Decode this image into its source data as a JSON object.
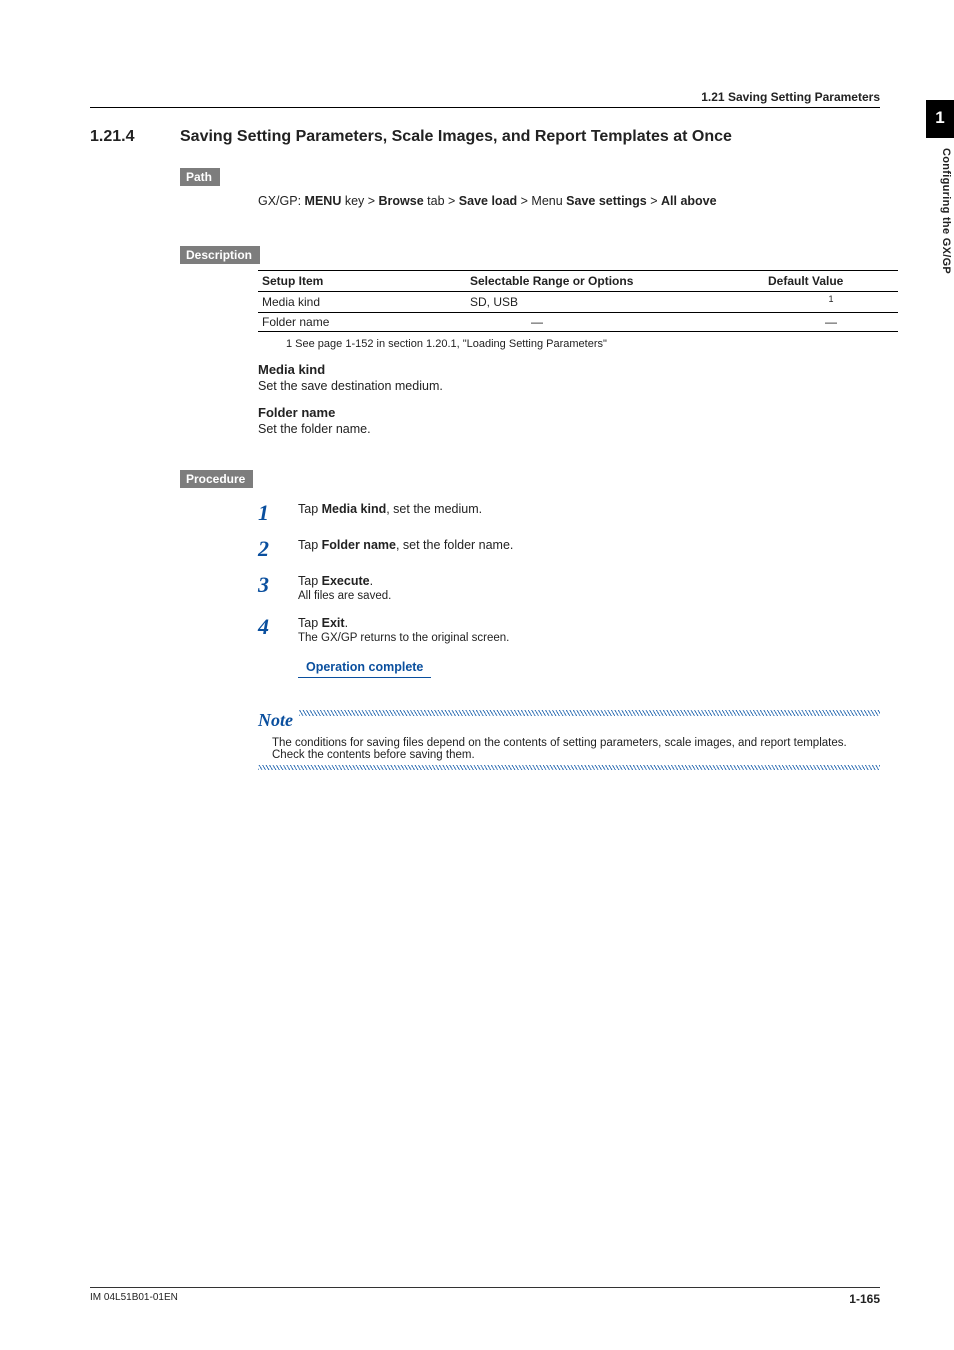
{
  "side_tab": "1",
  "side_label": "Configuring the GX/GP",
  "running_header": "1.21  Saving Setting Parameters",
  "section_number": "1.21.4",
  "section_title": "Saving Setting Parameters, Scale Images, and Report Templates at Once",
  "badges": {
    "path": "Path",
    "description": "Description",
    "procedure": "Procedure"
  },
  "path": {
    "prefix": "GX/GP: ",
    "k1": "MENU",
    "t1": " key > ",
    "k2": "Browse",
    "t2": " tab > ",
    "k3": "Save load",
    "t3": " > Menu ",
    "k4": "Save settings",
    "t4": " > ",
    "k5": "All above"
  },
  "table": {
    "headers": [
      "Setup Item",
      "Selectable Range or Options",
      "Default Value"
    ],
    "rows": [
      {
        "item": "Media kind",
        "options": "SD, USB",
        "default_sup": "1",
        "default": ""
      },
      {
        "item": "Folder name",
        "options": "—",
        "default": "—"
      }
    ],
    "footnote": "1   See page 1-152 in section 1.20.1, \"Loading Setting Parameters\""
  },
  "desc": {
    "h1": "Media kind",
    "t1": "Set the save destination medium.",
    "h2": "Folder name",
    "t2": "Set the folder name."
  },
  "steps": [
    {
      "n": "1",
      "pre": "Tap ",
      "bold": "Media kind",
      "post": ", set the medium."
    },
    {
      "n": "2",
      "pre": "Tap ",
      "bold": "Folder name",
      "post": ", set the folder name."
    },
    {
      "n": "3",
      "pre": "Tap ",
      "bold": "Execute",
      "post": ".",
      "sub": "All files are saved."
    },
    {
      "n": "4",
      "pre": "Tap ",
      "bold": "Exit",
      "post": ".",
      "sub": "The GX/GP returns to the original screen."
    }
  ],
  "operation_complete": "Operation complete",
  "note": {
    "label": "Note",
    "text": "The conditions for saving files depend on the contents of setting parameters, scale images, and report templates. Check the contents before saving them."
  },
  "footer": {
    "left": "IM 04L51B01-01EN",
    "right": "1-165"
  }
}
